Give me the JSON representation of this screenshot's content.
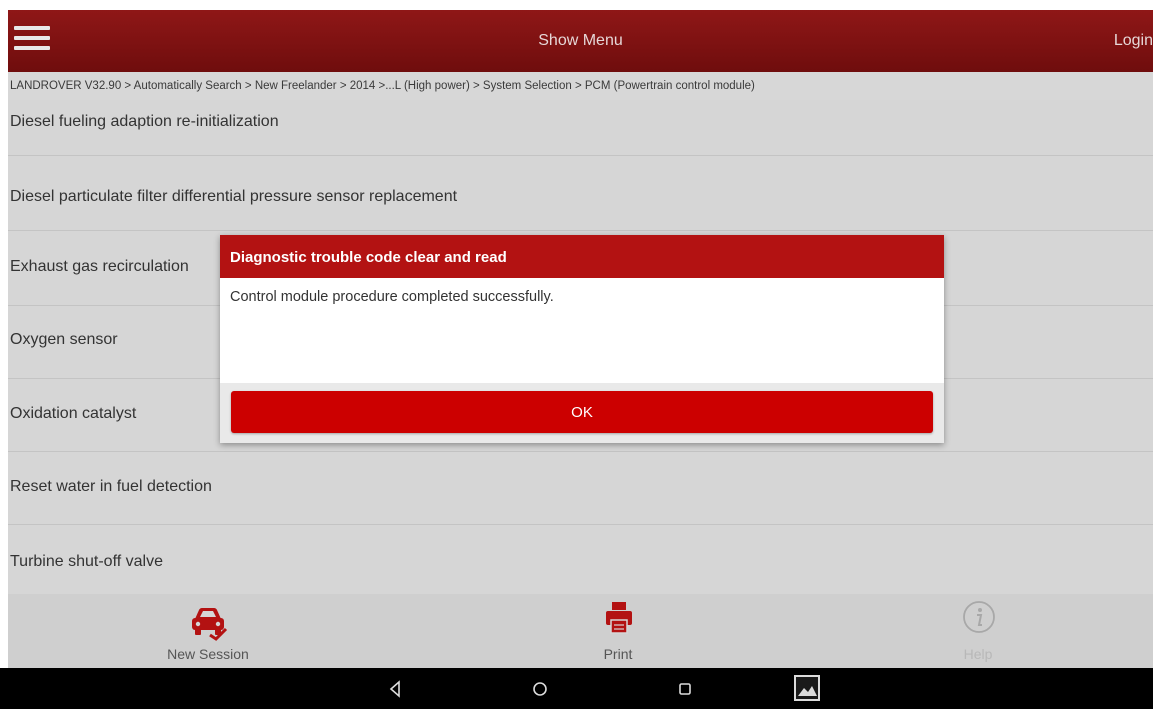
{
  "header": {
    "title": "Show Menu",
    "login_label": "Login",
    "menu_icon": "hamburger-icon"
  },
  "breadcrumb": "LANDROVER V32.90 > Automatically Search > New Freelander > 2014 >...L (High power) > System Selection > PCM (Powertrain control module)",
  "menu_items": [
    "Diesel fueling adaption re-initialization",
    "Diesel particulate filter differential pressure sensor replacement",
    "Exhaust gas recirculation",
    "Oxygen sensor",
    "Oxidation catalyst",
    "Reset water in fuel detection",
    "Turbine shut-off valve"
  ],
  "dialog": {
    "title": "Diagnostic trouble code clear and read",
    "message": "Control module procedure completed successfully.",
    "ok_label": "OK"
  },
  "toolbar": {
    "new_session_label": "New Session",
    "print_label": "Print",
    "help_label": "Help"
  },
  "colors": {
    "header_red": "#7f1010",
    "accent_red": "#cc0000",
    "help_gray": "#a8a8a8"
  }
}
